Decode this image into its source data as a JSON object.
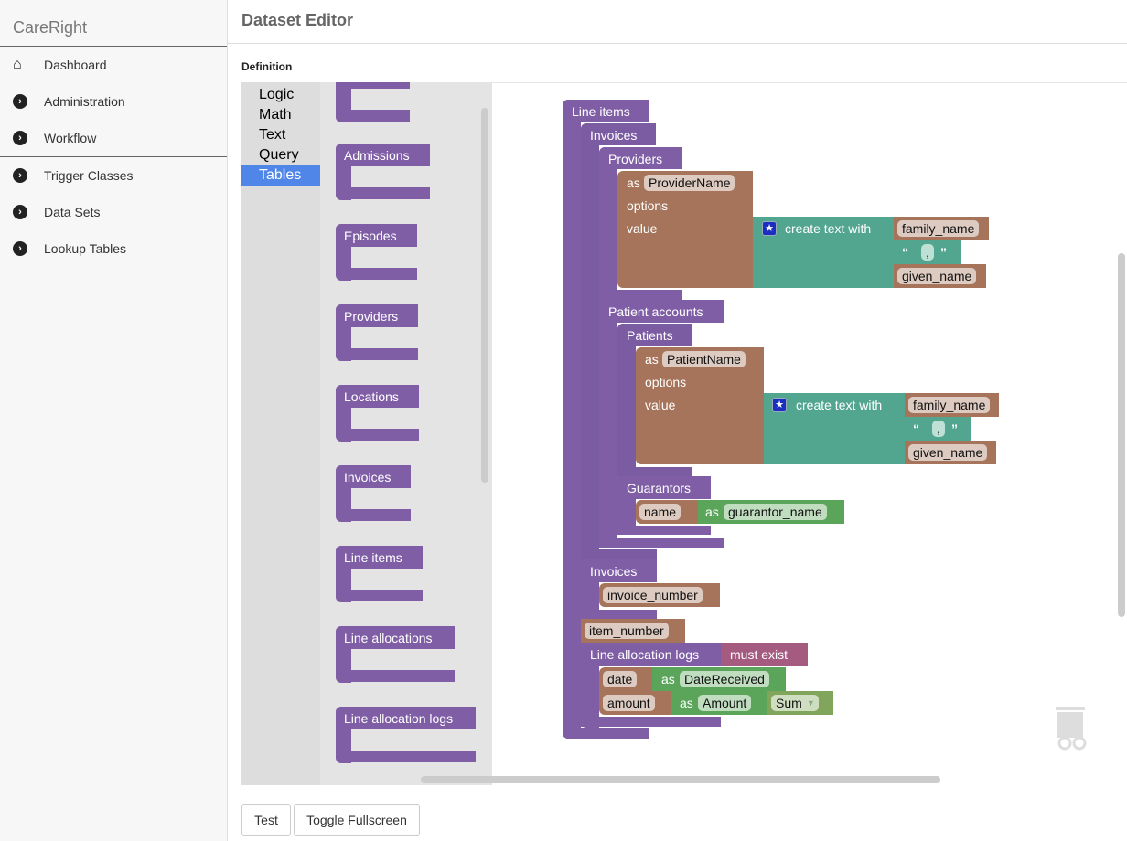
{
  "app": {
    "brand": "CareRight"
  },
  "sidebar": {
    "items": [
      {
        "label": "Dashboard",
        "icon": "home-icon"
      },
      {
        "label": "Administration",
        "icon": "chevron-circle-right-icon"
      },
      {
        "label": "Workflow",
        "icon": "chevron-circle-right-icon"
      },
      {
        "label": "Trigger Classes",
        "icon": "chevron-circle-right-icon"
      },
      {
        "label": "Data Sets",
        "icon": "chevron-circle-right-icon"
      },
      {
        "label": "Lookup Tables",
        "icon": "chevron-circle-right-icon"
      }
    ]
  },
  "page": {
    "title": "Dataset Editor",
    "section": "Definition"
  },
  "toolbox": {
    "categories": [
      "Logic",
      "Math",
      "Text",
      "Query",
      "Tables"
    ],
    "selected": "Tables"
  },
  "flyout": {
    "blocks": [
      "Admissions",
      "Episodes",
      "Providers",
      "Locations",
      "Invoices",
      "Line items",
      "Line allocations",
      "Line allocation logs"
    ]
  },
  "workspace": {
    "line_items": "Line items",
    "invoices": "Invoices",
    "providers": "Providers",
    "as": "as",
    "provider_name": "ProviderName",
    "options": "options",
    "value": "value",
    "create_text_with": "create text with",
    "family_name": "family_name",
    "comma": ",",
    "open_quote": "“",
    "close_quote": "”",
    "given_name": "given_name",
    "patient_accounts": "Patient accounts",
    "patients": "Patients",
    "patient_name": "PatientName",
    "guarantors": "Guarantors",
    "name": "name",
    "guarantor_name": "guarantor_name",
    "invoices2": "Invoices",
    "invoice_number": "invoice_number",
    "item_number": "item_number",
    "line_allocation_logs": "Line allocation logs",
    "must_exist": "must exist",
    "date": "date",
    "date_received": "DateReceived",
    "amount": "amount",
    "amount_alias": "Amount",
    "sum": "Sum"
  },
  "buttons": {
    "test": "Test",
    "toggle_fullscreen": "Toggle Fullscreen"
  },
  "colors": {
    "table_block": "#7f5ea6",
    "field_block": "#a5745a",
    "text_block": "#52a58f",
    "alias_block": "#5ba55b",
    "condition_block": "#a55b80",
    "aggregate_block": "#80a55b",
    "selected_category": "#5086e8"
  }
}
